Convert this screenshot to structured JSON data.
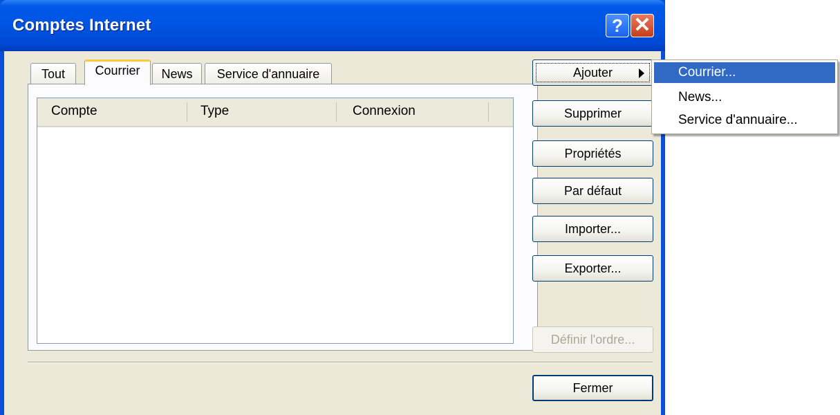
{
  "window": {
    "title": "Comptes Internet"
  },
  "titlebar_buttons": {
    "help": "?",
    "close": "✕"
  },
  "tabs": [
    {
      "label": "Tout",
      "active": false
    },
    {
      "label": "Courrier",
      "active": true
    },
    {
      "label": "News",
      "active": false
    },
    {
      "label": "Service d'annuaire",
      "active": false
    }
  ],
  "listview": {
    "columns": [
      "Compte",
      "Type",
      "Connexion"
    ],
    "rows": []
  },
  "buttons": {
    "add": "Ajouter",
    "remove": "Supprimer",
    "properties": "Propriétés",
    "default": "Par défaut",
    "import": "Importer...",
    "export": "Exporter...",
    "set_order": "Définir l'ordre...",
    "close": "Fermer"
  },
  "add_menu": {
    "items": [
      {
        "label": "Courrier...",
        "highlighted": true
      },
      {
        "label": "News..."
      },
      {
        "label": "Service d'annuaire..."
      }
    ]
  },
  "colors": {
    "titlebar": "#0054e3",
    "dialog_bg": "#ece9d8",
    "menu_highlight": "#316ac5",
    "active_tab_accent": "#ffc83c"
  }
}
